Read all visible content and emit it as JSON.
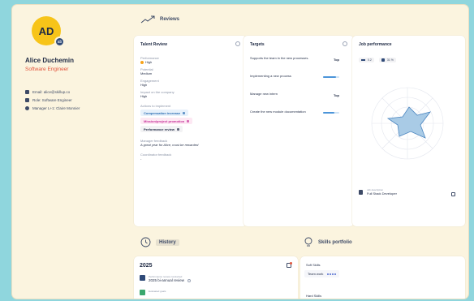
{
  "profile": {
    "initials": "AD",
    "badge": "ab",
    "name": "Alice Duchemin",
    "role": "Software Engineer",
    "email": "Email: alice@skillup.co",
    "role_line": "Role: Software Engineer",
    "manager": "Manager L+1: Claire Monnier"
  },
  "sections": {
    "reviews": "Reviews",
    "history": "History",
    "skills": "Skills portfolio"
  },
  "talent_review": {
    "title": "Talent Review",
    "performance_label": "Performance",
    "performance_value": "High",
    "potential_label": "Potential",
    "potential_value": "Medium",
    "engagement_label": "Engagement",
    "engagement_value": "High",
    "impact_label": "Impact on the company",
    "impact_value": "High",
    "actions_label": "Actions to implement",
    "actions": [
      "Compensation increase",
      "Mission/project promotion",
      "Performance review"
    ],
    "manager_feedback_label": "Manager feedback",
    "manager_feedback": "A great year for Alice, must be rewarded",
    "coordinator_feedback_label": "Coordinator feedback",
    "coordinator_feedback": "-"
  },
  "targets": {
    "title": "Targets",
    "items": [
      {
        "text": "Supports the team in the new processes.",
        "status": "Top",
        "progress": null
      },
      {
        "text": "Implementing a new process",
        "status": "",
        "progress": 0.8
      },
      {
        "text": "Manage new intern",
        "status": "Top",
        "progress": null
      },
      {
        "text": "Create the new module documentation",
        "status": "",
        "progress": 0.7
      }
    ]
  },
  "job_performance": {
    "title": "Job performance",
    "legend": [
      "0.2",
      "31 %"
    ],
    "job_description_label": "Job description",
    "job_description_value": "Full Stack Developer"
  },
  "history": {
    "year": "2025",
    "items": [
      {
        "kicker": "Performance review conducted",
        "title": "2025 bi-annual review"
      },
      {
        "kicker": "Evaluated goals",
        "title": ""
      }
    ]
  },
  "skills": {
    "soft_label": "Soft Skills",
    "soft_chip": "Team work",
    "hard_label": "Hard Skills"
  },
  "colors": {
    "accent": "#f7c419",
    "role": "#e1523a",
    "primary": "#2f4a78",
    "background": "#fbf4df",
    "outer": "#8fd6dd"
  }
}
